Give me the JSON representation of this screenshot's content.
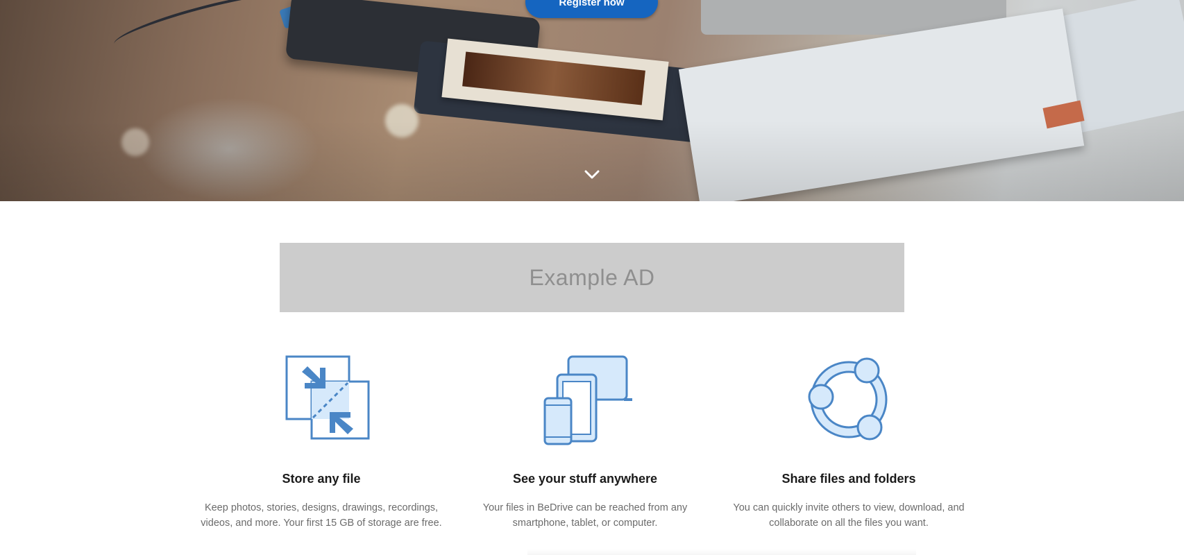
{
  "hero": {
    "register_label": "Register now",
    "scroll_icon": "chevron-down-icon"
  },
  "ad": {
    "text": "Example AD"
  },
  "features": [
    {
      "icon": "compress-arrows-icon",
      "title": "Store any file",
      "line1": "Keep photos, stories, designs, drawings, recordings,",
      "line2": "videos, and more. Your first 15 GB of storage are free."
    },
    {
      "icon": "devices-icon",
      "title": "See your stuff anywhere",
      "line1": "Your files in BeDrive can be reached from any",
      "line2": "smartphone, tablet, or computer."
    },
    {
      "icon": "share-network-icon",
      "title": "Share files and folders",
      "line1": "You can quickly invite others to view, download, and",
      "line2": "collaborate on all the files you want."
    }
  ],
  "colors": {
    "accent": "#1565c0",
    "icon_stroke": "#4a86c6",
    "icon_fill": "#d6e9fb",
    "ad_bg": "#cccccc"
  }
}
